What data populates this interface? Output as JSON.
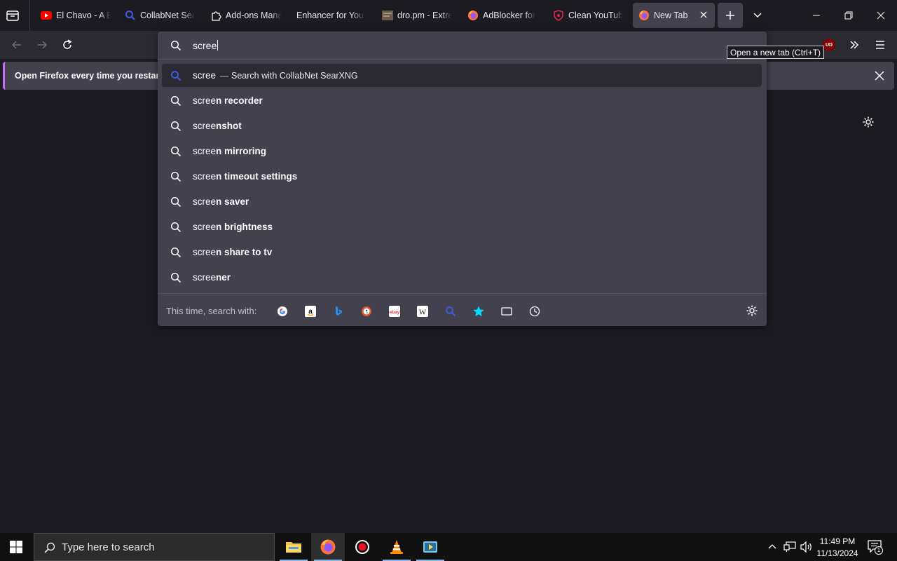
{
  "tabs": [
    {
      "label": "El Chavo - A B",
      "icon": "youtube-icon"
    },
    {
      "label": "CollabNet Sear",
      "icon": "search-icon"
    },
    {
      "label": "Add-ons Mana",
      "icon": "puzzle-icon"
    },
    {
      "label": "Enhancer for YouTu",
      "icon": "none"
    },
    {
      "label": "dro.pm - Extre",
      "icon": "site-thumbnail-icon"
    },
    {
      "label": "AdBlocker for",
      "icon": "firefox-icon"
    },
    {
      "label": "Clean YouTube",
      "icon": "shield-icon"
    },
    {
      "label": "New Tab",
      "icon": "firefox-icon"
    }
  ],
  "notification": {
    "text": "Open Firefox every time you restart y"
  },
  "urlbar": {
    "typed": "scree",
    "heuristic": {
      "query": "scree",
      "separator": "—",
      "engine_text": "Search with CollabNet SearXNG"
    },
    "suggestions": [
      {
        "prefix": "scree",
        "rest": "n recorder"
      },
      {
        "prefix": "scree",
        "rest": "nshot"
      },
      {
        "prefix": "scree",
        "rest": "n mirroring"
      },
      {
        "prefix": "scree",
        "rest": "n timeout settings"
      },
      {
        "prefix": "scree",
        "rest": "n saver"
      },
      {
        "prefix": "scree",
        "rest": "n brightness"
      },
      {
        "prefix": "scree",
        "rest": "n share to tv"
      },
      {
        "prefix": "scree",
        "rest": "ner"
      }
    ],
    "oneoff_label": "This time, search with:",
    "oneoff_engines": [
      "google-icon",
      "amazon-icon",
      "bing-icon",
      "duckduckgo-icon",
      "ebay-icon",
      "wikipedia-icon",
      "searxng-icon",
      "bookmarks-icon",
      "tabs-icon",
      "history-icon"
    ]
  },
  "tooltip": "Open a new tab (Ctrl+T)",
  "ublock_badge": "UD",
  "taskbar": {
    "search_placeholder": "Type here to search",
    "time": "11:49 PM",
    "date": "11/13/2024",
    "notification_count": "1"
  },
  "colors": {
    "accent": "#c56cf0",
    "searx_blue": "#3b5bdb",
    "bg": "#1c1b22",
    "panel": "#42414d"
  }
}
